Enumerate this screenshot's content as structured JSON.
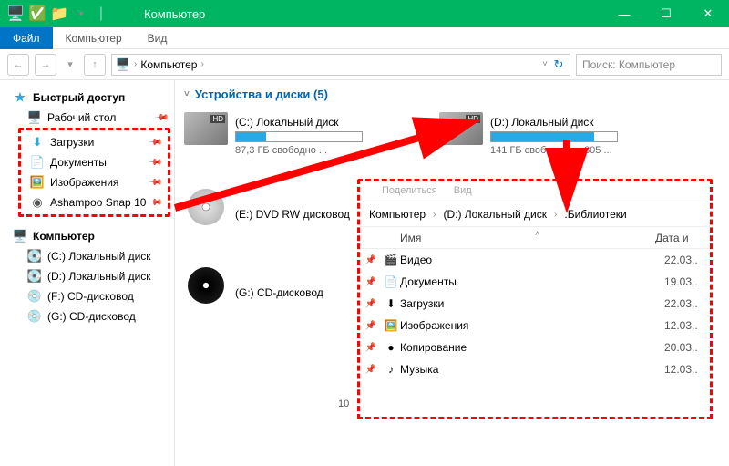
{
  "window": {
    "title": "Компьютер",
    "minimize": "—",
    "maximize": "☐",
    "close": "✕"
  },
  "ribbon": {
    "file": "Файл",
    "computer": "Компьютер",
    "view": "Вид"
  },
  "address": {
    "root": "Компьютер",
    "search_placeholder": "Поиск: Компьютер"
  },
  "sidebar": {
    "quick": "Быстрый доступ",
    "quick_items": [
      {
        "icon": "🖥️",
        "label": "Рабочий стол"
      },
      {
        "icon": "⬇",
        "label": "Загрузки"
      },
      {
        "icon": "📄",
        "label": "Документы"
      },
      {
        "icon": "🖼️",
        "label": "Изображения"
      },
      {
        "icon": "◉",
        "label": "Ashampoo Snap 10"
      }
    ],
    "computer": "Компьютер",
    "drives": [
      "(C:) Локальный диск",
      "(D:) Локальный диск",
      "(F:) CD-дисковод",
      "(G:) CD-дисковод"
    ]
  },
  "section": {
    "title": "Устройства и диски (5)"
  },
  "drives": [
    {
      "name": "(C:) Локальный диск",
      "free": "87,3 ГБ свободно ...",
      "pct": 24,
      "type": "hd"
    },
    {
      "name": "(D:) Локальный диск",
      "free": "141 ГБ свободно из 805 ...",
      "pct": 82,
      "type": "hd"
    },
    {
      "name": "(E:) DVD RW дисковод",
      "free": "",
      "pct": 0,
      "type": "dvd"
    },
    {
      "name": "(F:) CD-дисковод",
      "free": "",
      "pct": 0,
      "type": "cd"
    },
    {
      "name": "(G:) CD-дисковод",
      "free": "",
      "pct": 0,
      "type": "cd"
    }
  ],
  "folderview": {
    "tabs": [
      "Поделиться",
      "Вид"
    ],
    "crumb": [
      "Компьютер",
      "(D:) Локальный диск",
      ".Библиотеки"
    ],
    "col_name": "Имя",
    "col_date": "Дата и",
    "items_count": "10",
    "rows": [
      {
        "icon": "🎬",
        "name": "Видео",
        "date": "22.03.."
      },
      {
        "icon": "📄",
        "name": "Документы",
        "date": "19.03.."
      },
      {
        "icon": "⬇",
        "name": "Загрузки",
        "date": "22.03.."
      },
      {
        "icon": "🖼️",
        "name": "Изображения",
        "date": "12.03.."
      },
      {
        "icon": "●",
        "name": "Копирование",
        "date": "20.03.."
      },
      {
        "icon": "♪",
        "name": "Музыка",
        "date": "12.03.."
      }
    ]
  }
}
